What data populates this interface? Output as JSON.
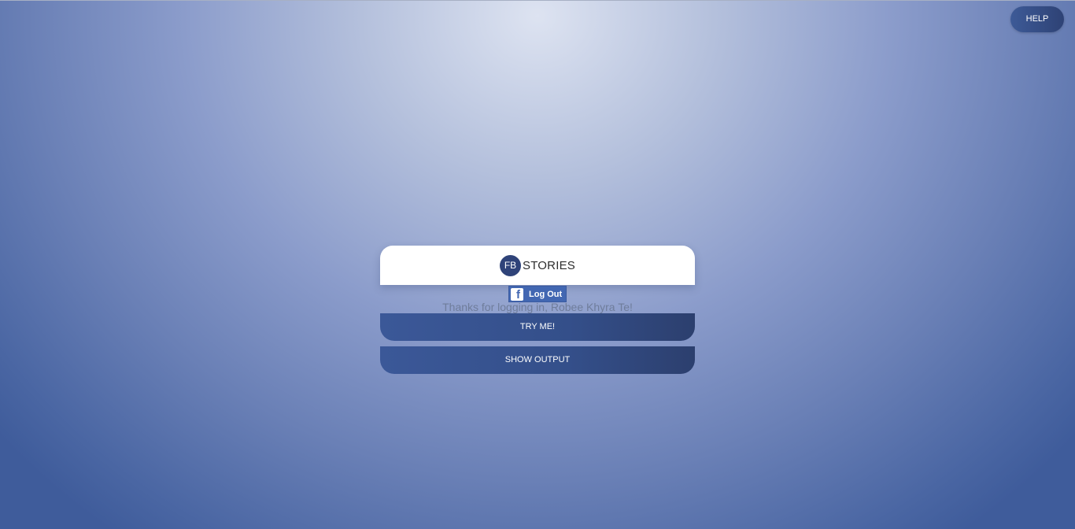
{
  "header": {
    "help_label": "HELP"
  },
  "card": {
    "logo_badge": "FB",
    "logo_text": "STORIES"
  },
  "facebook": {
    "icon_glyph": "f",
    "logout_label": "Log Out"
  },
  "message": {
    "thanks": "Thanks for logging in, Robee Khyra Te!"
  },
  "actions": {
    "try_label": "TRY ME!",
    "output_label": "SHOW OUTPUT"
  },
  "colors": {
    "accent": "#3b5898",
    "facebook_blue": "#4267b2",
    "badge": "#2f4379"
  }
}
